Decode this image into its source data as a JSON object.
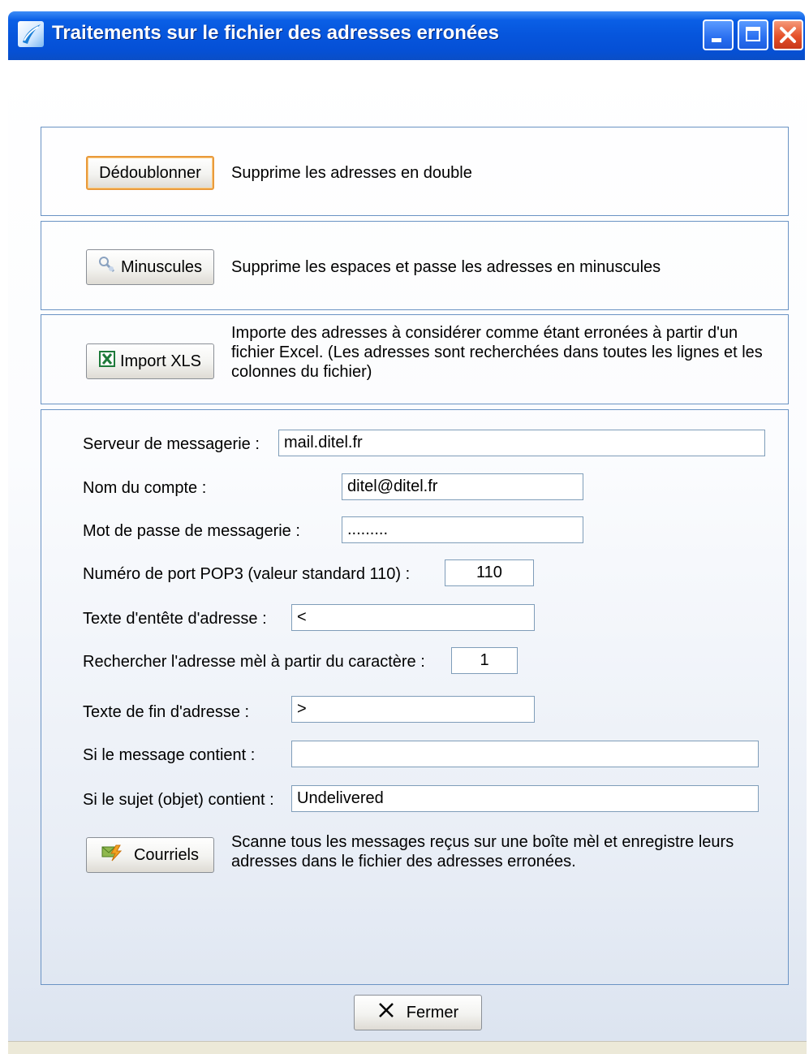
{
  "window": {
    "title": "Traitements sur le fichier des adresses erronées"
  },
  "actions": {
    "dedup": {
      "label": "Dédoublonner",
      "description": "Supprime les adresses en double"
    },
    "lowercase": {
      "label": "Minuscules",
      "description": "Supprime les espaces et passe les adresses en minuscules"
    },
    "import_xls": {
      "label": "Import XLS",
      "description": "Importe des adresses à considérer comme étant erronées à partir d'un fichier Excel. (Les adresses sont recherchées dans toutes les lignes et les colonnes du fichier)"
    }
  },
  "mail_settings": {
    "server": {
      "label": "Serveur de messagerie :",
      "value": "mail.ditel.fr"
    },
    "account": {
      "label": "Nom du compte :",
      "value": "ditel@ditel.fr"
    },
    "password": {
      "label": "Mot de passe de messagerie :",
      "value": "........."
    },
    "port": {
      "label": "Numéro de port POP3 (valeur standard 110) :",
      "value": "110"
    },
    "header_text": {
      "label": "Texte d'entête d'adresse :",
      "value": "<"
    },
    "start_char": {
      "label": "Rechercher l'adresse mèl à partir du caractère :",
      "value": "1"
    },
    "end_text": {
      "label": "Texte de fin d'adresse :",
      "value": ">"
    },
    "message_contains": {
      "label": "Si le message contient :",
      "value": ""
    },
    "subject_contains": {
      "label": "Si le sujet (objet) contient :",
      "value": "Undelivered"
    }
  },
  "emails": {
    "label": "Courriels",
    "description": "Scanne tous les messages reçus sur une boîte mèl et enregistre leurs adresses dans le fichier des adresses erronées."
  },
  "footer": {
    "close_label": "Fermer"
  },
  "colors": {
    "titlebar": "#0655dc",
    "group_border": "#6a93c4",
    "focus": "#e99a3c"
  }
}
